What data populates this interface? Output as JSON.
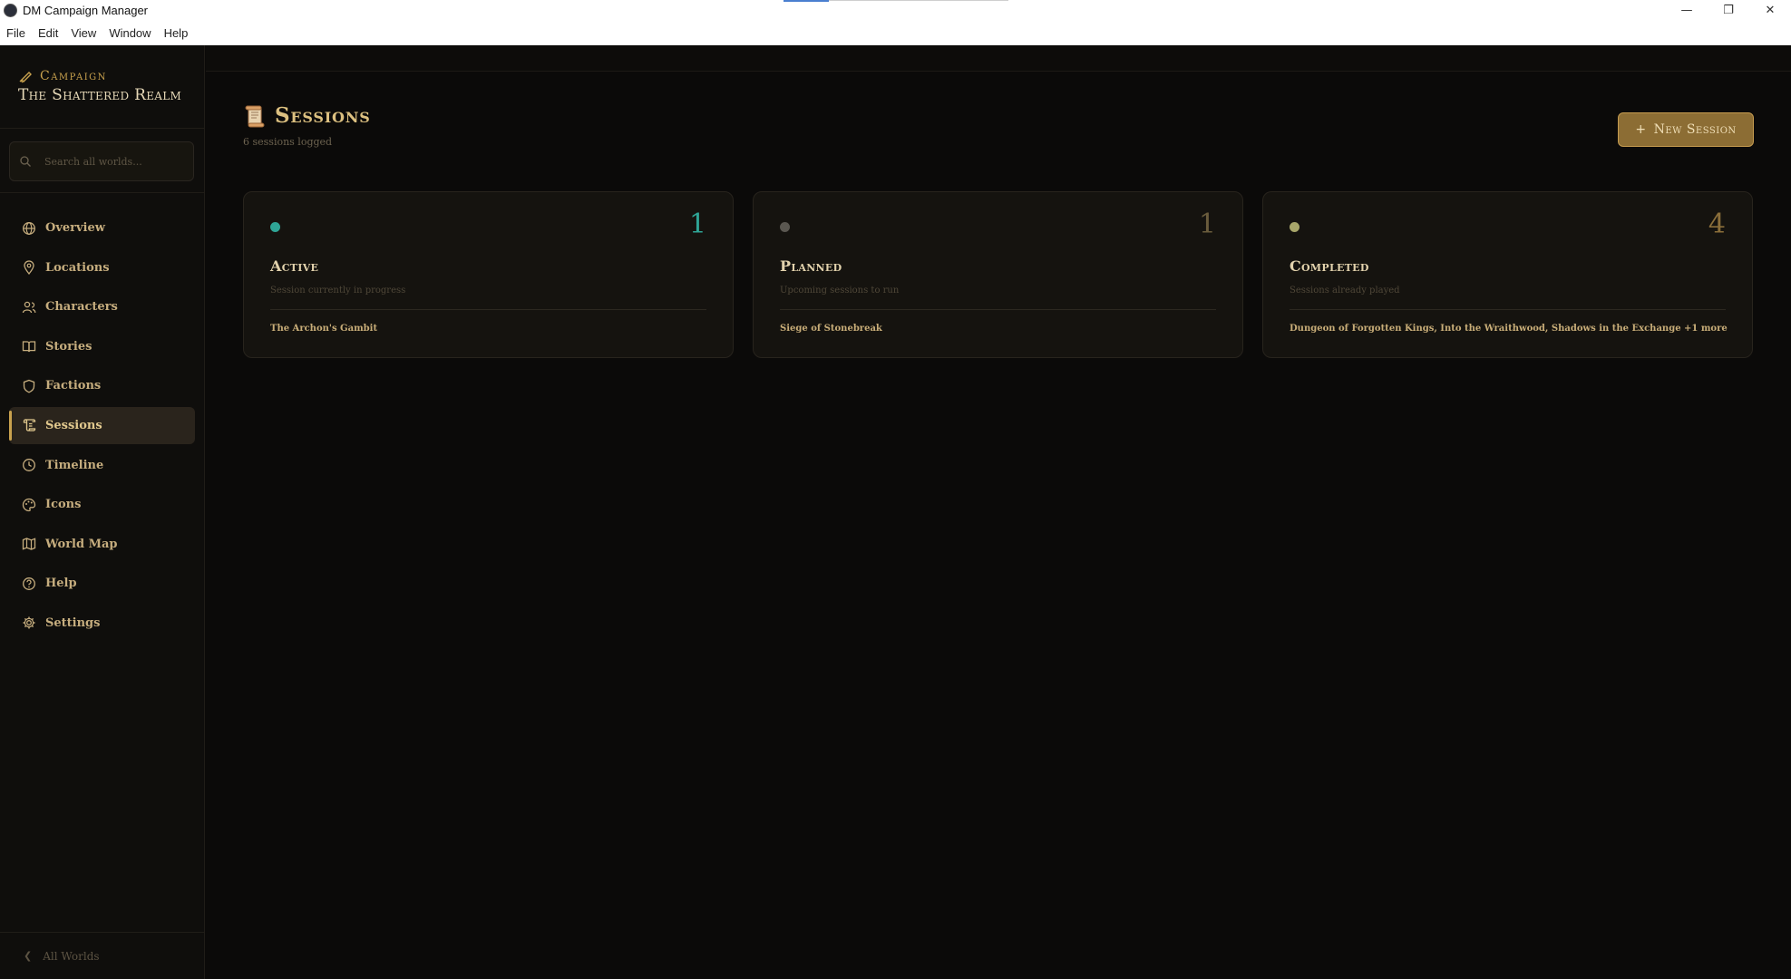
{
  "window": {
    "title": "DM Campaign Manager",
    "controls": [
      "minimize",
      "restore",
      "close"
    ]
  },
  "menu": [
    "File",
    "Edit",
    "View",
    "Window",
    "Help"
  ],
  "sidebar": {
    "kicker": "Campaign",
    "campaign_name": "The Shattered Realm",
    "search_placeholder": "Search all worlds...",
    "items": [
      {
        "label": "Overview",
        "icon": "globe-icon"
      },
      {
        "label": "Locations",
        "icon": "map-pin-icon"
      },
      {
        "label": "Characters",
        "icon": "users-icon"
      },
      {
        "label": "Stories",
        "icon": "book-icon"
      },
      {
        "label": "Factions",
        "icon": "shield-icon"
      },
      {
        "label": "Sessions",
        "icon": "scroll-icon",
        "active": true
      },
      {
        "label": "Timeline",
        "icon": "clock-icon"
      },
      {
        "label": "Icons",
        "icon": "palette-icon"
      },
      {
        "label": "World Map",
        "icon": "map-icon"
      },
      {
        "label": "Help",
        "icon": "help-circle-icon"
      },
      {
        "label": "Settings",
        "icon": "gear-icon"
      }
    ],
    "footer_label": "All Worlds"
  },
  "page": {
    "title": "Sessions",
    "subtitle": "6 sessions logged",
    "new_button_label": "New Session"
  },
  "cards": [
    {
      "title": "Active",
      "count": "1",
      "description": "Session currently in progress",
      "sessions": "The Archon's Gambit",
      "dot_color": "#2fa596",
      "count_color": "#2fa596"
    },
    {
      "title": "Planned",
      "count": "1",
      "description": "Upcoming sessions to run",
      "sessions": "Siege of Stonebreak",
      "dot_color": "#5a5750",
      "count_color": "#6a5c3c"
    },
    {
      "title": "Completed",
      "count": "4",
      "description": "Sessions already played",
      "sessions": "Dungeon of Forgotten Kings, Into the Wraithwood, Shadows in the Exchange +1 more",
      "dot_color": "#a8a66a",
      "count_color": "#8a6e3a"
    }
  ],
  "colors": {
    "accent": "#c9a24e",
    "background": "#0b0a09",
    "sidebar": "#0f0e0c",
    "card": "#15130f"
  }
}
